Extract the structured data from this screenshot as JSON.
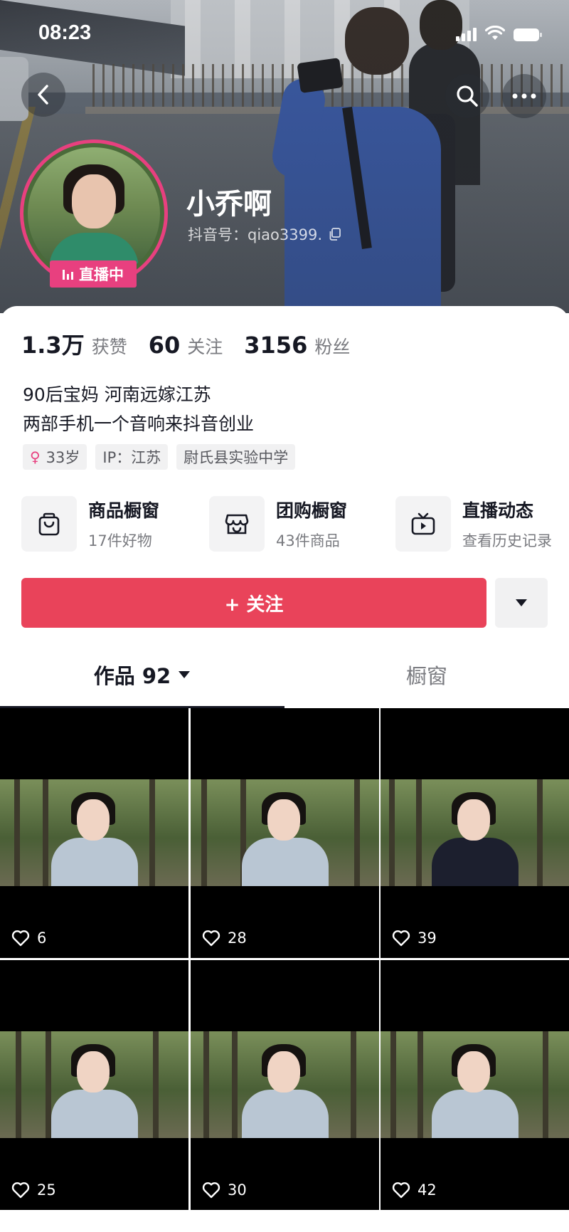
{
  "status_bar": {
    "time": "08:23"
  },
  "profile": {
    "nickname": "小乔啊",
    "douyin_id": "抖音号：qiao3399.",
    "live_badge": "直播中"
  },
  "stats": [
    {
      "value": "1.3万",
      "label": "获赞"
    },
    {
      "value": "60",
      "label": "关注"
    },
    {
      "value": "3156",
      "label": "粉丝"
    }
  ],
  "bio": {
    "line1": "90后宝妈 河南远嫁江苏",
    "line2": "两部手机一个音响来抖音创业"
  },
  "tags": {
    "age": "33岁",
    "ip": "IP：江苏",
    "school": "尉氏县实验中学"
  },
  "shortcuts": [
    {
      "title": "商品橱窗",
      "subtitle": "17件好物",
      "icon": "shopping-bag-icon"
    },
    {
      "title": "团购橱窗",
      "subtitle": "43件商品",
      "icon": "store-icon"
    },
    {
      "title": "直播动态",
      "subtitle": "查看历史记录",
      "icon": "tv-icon"
    }
  ],
  "follow_button": {
    "label": "+ 关注"
  },
  "tabs": {
    "works": "作品 92",
    "shop": "橱窗"
  },
  "videos": [
    {
      "likes": "6"
    },
    {
      "likes": "28"
    },
    {
      "likes": "39"
    },
    {
      "likes": "25"
    },
    {
      "likes": "30"
    },
    {
      "likes": "42"
    }
  ],
  "colors": {
    "accent": "#e9435a",
    "live_pink": "#e8407f",
    "text_primary": "#161823",
    "text_secondary": "#7a7b80"
  }
}
